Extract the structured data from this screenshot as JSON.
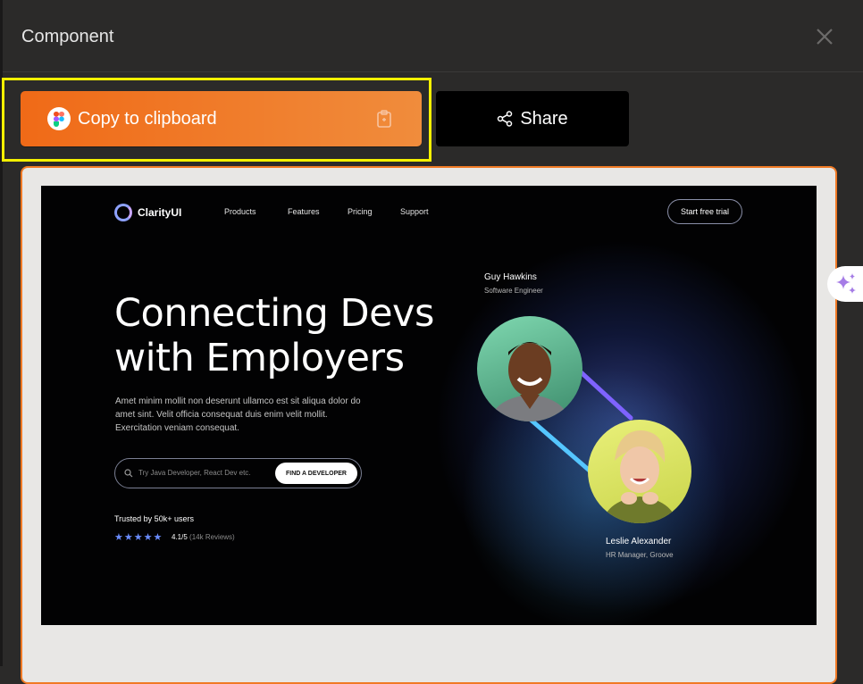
{
  "panel": {
    "title": "Component"
  },
  "actions": {
    "copy_label": "Copy to clipboard",
    "share_label": "Share"
  },
  "preview": {
    "brand": "ClarityUI",
    "nav": [
      "Products",
      "Features",
      "Pricing",
      "Support"
    ],
    "cta": "Start free trial",
    "hero_line1": "Connecting Devs",
    "hero_line2": "with Employers",
    "description": "Amet minim mollit non deserunt ullamco est sit aliqua dolor do amet sint. Velit officia consequat duis enim velit mollit. Exercitation veniam consequat.",
    "search_placeholder": "Try Java Developer, React Dev etc.",
    "find_button": "FIND A DEVELOPER",
    "trusted": "Trusted by 50k+ users",
    "stars": "★★★★★",
    "rating": "4.1/5",
    "reviews": "(14k Reviews)",
    "person1": {
      "name": "Guy Hawkins",
      "role": "Software Engineer"
    },
    "person2": {
      "name": "Leslie Alexander",
      "role": "HR Manager, Groove"
    }
  },
  "colors": {
    "accent": "#f06a17",
    "highlight": "#f4f000",
    "background": "#2b2a29"
  },
  "icons": [
    "close-icon",
    "figma-icon",
    "clipboard-icon",
    "share-icon",
    "search-icon",
    "sparkle-icon"
  ]
}
